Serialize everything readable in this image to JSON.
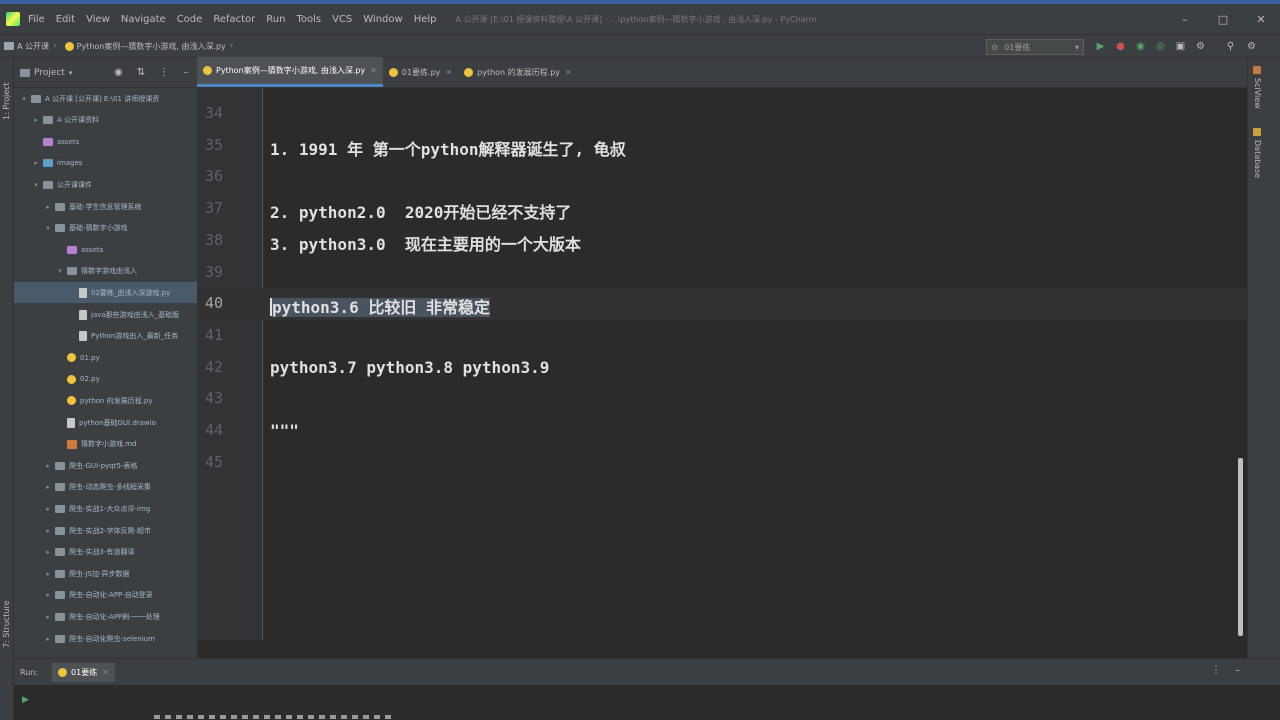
{
  "menu": {
    "items": [
      "File",
      "Edit",
      "View",
      "Navigate",
      "Code",
      "Refactor",
      "Run",
      "Tools",
      "VCS",
      "Window",
      "Help"
    ],
    "window_title": "A 公开课 [E:\\01 授课资料整理\\A 公开课] - ...\\python案例—猜数字小游戏 , 由浅入深.py - PyCharm"
  },
  "breadcrumb": {
    "root": "A 公开课",
    "file": "Python案例—猜数字小游戏, 由浅入深.py"
  },
  "toolbar": {
    "run_config": "01要练"
  },
  "project": {
    "title": "Project",
    "tree": [
      {
        "label": "A 公开课 [公开课] E:\\01 讲师授课资",
        "kind": "folder",
        "depth": 0,
        "open": true
      },
      {
        "label": "A 公开课资料",
        "kind": "folder",
        "depth": 1,
        "open": false
      },
      {
        "label": "assets",
        "kind": "pfolder",
        "depth": 1,
        "open": null
      },
      {
        "label": "images",
        "kind": "ifolder",
        "depth": 1,
        "open": false
      },
      {
        "label": "公开课课件",
        "kind": "folder",
        "depth": 1,
        "open": true
      },
      {
        "label": "基础-学生信息管理系统",
        "kind": "folder",
        "depth": 2,
        "open": false
      },
      {
        "label": "基础-猜数字小游戏",
        "kind": "folder",
        "depth": 2,
        "open": true
      },
      {
        "label": "assets",
        "kind": "pfolder",
        "depth": 3,
        "open": null
      },
      {
        "label": "猜数字游戏由浅入",
        "kind": "folder",
        "depth": 3,
        "open": true
      },
      {
        "label": "02要练_由浅入深游戏.py",
        "kind": "doc",
        "depth": 4,
        "open": null,
        "selected": true
      },
      {
        "label": "java那些游戏由浅入_基础版",
        "kind": "doc",
        "depth": 4,
        "open": null
      },
      {
        "label": "Python游戏由入_最新_任务",
        "kind": "doc",
        "depth": 4,
        "open": null
      },
      {
        "label": "01.py",
        "kind": "py",
        "depth": 3,
        "open": null
      },
      {
        "label": "02.py",
        "kind": "py",
        "depth": 3,
        "open": null
      },
      {
        "label": "python 的发展历程.py",
        "kind": "py",
        "depth": 3,
        "open": null
      },
      {
        "label": "python基础GUI.drawio",
        "kind": "doc",
        "depth": 3,
        "open": null
      },
      {
        "label": "猜数字小游戏.md",
        "kind": "md",
        "depth": 3,
        "open": null
      },
      {
        "label": "爬虫-GUI-pyqt5-表格",
        "kind": "folder",
        "depth": 2,
        "open": false
      },
      {
        "label": "爬虫-动态爬虫-多线程采集",
        "kind": "folder",
        "depth": 2,
        "open": false
      },
      {
        "label": "爬虫-实战1-大众点评-img",
        "kind": "folder",
        "depth": 2,
        "open": false
      },
      {
        "label": "爬虫-实战2-字体反爬-超市",
        "kind": "folder",
        "depth": 2,
        "open": false
      },
      {
        "label": "爬虫-实战3-有道翻译",
        "kind": "folder",
        "depth": 2,
        "open": false
      },
      {
        "label": "爬虫-JS加-异步数据",
        "kind": "folder",
        "depth": 2,
        "open": false
      },
      {
        "label": "爬虫-自动化-APP-自动登录",
        "kind": "folder",
        "depth": 2,
        "open": false
      },
      {
        "label": "爬虫-自动化-APP刷-一一处理",
        "kind": "folder",
        "depth": 2,
        "open": false
      },
      {
        "label": "爬虫-自动化爬虫-selenium",
        "kind": "folder",
        "depth": 2,
        "open": false
      }
    ]
  },
  "tabs": [
    {
      "label": "Python案例—猜数字小游戏, 由浅入深.py",
      "active": true
    },
    {
      "label": "01要练.py",
      "active": false
    },
    {
      "label": "python 的发展历程.py",
      "active": false
    }
  ],
  "editor": {
    "current_line": 40,
    "lines": [
      {
        "num": "34",
        "text": ""
      },
      {
        "num": "35",
        "text": "1. 1991 年 第一个python解释器诞生了, 龟叔"
      },
      {
        "num": "36",
        "text": ""
      },
      {
        "num": "37",
        "text": "2. python2.0  2020开始已经不支持了"
      },
      {
        "num": "38",
        "text": "3. python3.0  现在主要用的一个大版本"
      },
      {
        "num": "39",
        "text": ""
      },
      {
        "num": "40",
        "text": "python3.6 比较旧 非常稳定"
      },
      {
        "num": "41",
        "text": ""
      },
      {
        "num": "42",
        "text": "python3.7 python3.8 python3.9"
      },
      {
        "num": "43",
        "text": ""
      },
      {
        "num": "44",
        "text": "\"\"\""
      },
      {
        "num": "45",
        "text": ""
      }
    ]
  },
  "run_panel": {
    "label": "Run:",
    "tab": "01要练"
  },
  "side_labels": {
    "project": "1: Project",
    "structure": "7: Structure",
    "scview": "SciView",
    "database": "Database"
  }
}
